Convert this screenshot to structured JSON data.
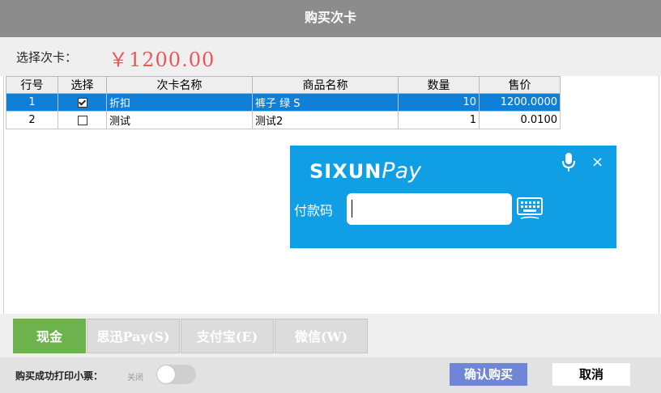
{
  "window": {
    "title": "购买次卡"
  },
  "selection": {
    "label": "选择次卡：",
    "amount": "￥1200.00"
  },
  "table": {
    "headers": [
      "行号",
      "选择",
      "次卡名称",
      "商品名称",
      "数量",
      "售价"
    ],
    "rows": [
      {
        "num": "1",
        "checked": true,
        "card_name": "折扣",
        "product": "裤子 绿 S",
        "qty": "10",
        "price": "1200.0000"
      },
      {
        "num": "2",
        "checked": false,
        "card_name": "测试",
        "product": "测试2",
        "qty": "1",
        "price": "0.0100"
      }
    ]
  },
  "pay": {
    "brand_prefix": "SIXUN",
    "brand_suffix": "Pay",
    "code_label": "付款码",
    "code_value": "",
    "close": "×",
    "mic_icon": "microphone-icon",
    "keyboard_icon": "keyboard-icon"
  },
  "tabs": [
    {
      "label": "现金",
      "active": true
    },
    {
      "label": "思迅Pay(S)",
      "active": false
    },
    {
      "label": "支付宝(E)",
      "active": false
    },
    {
      "label": "微信(W)",
      "active": false
    }
  ],
  "footer": {
    "print_label": "购买成功打印小票：",
    "toggle_state": "关闭",
    "toggle_on": false,
    "confirm": "确认购买",
    "cancel": "取消"
  },
  "colors": {
    "title_bar": "#8c8c8c",
    "amount": "#e8575a",
    "row_selected": "#0f7fd8",
    "pay_panel": "#109fe5",
    "tab_active": "#6db24c",
    "confirm_button": "#6f86d6"
  }
}
